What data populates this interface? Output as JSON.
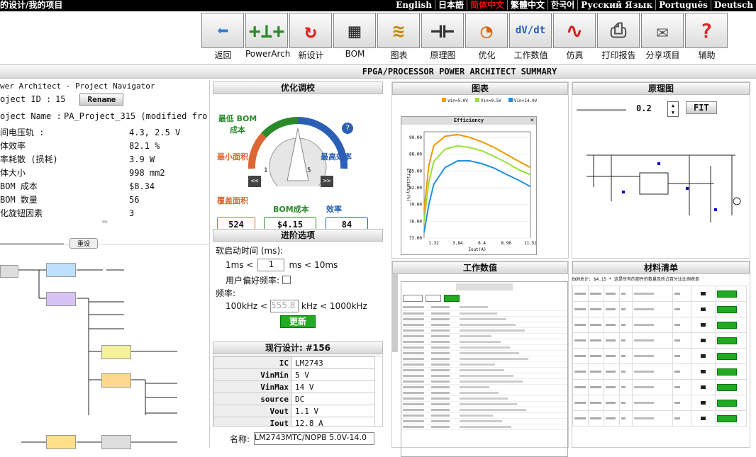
{
  "topbar": {
    "crumb": "的设计/我的项目",
    "languages": [
      "English",
      "日本語",
      "简体中文",
      "繁體中文",
      "한국어",
      "Русский Язык",
      "Português",
      "Deutsch"
    ],
    "active": "简体中文"
  },
  "toolbar": [
    {
      "label": "返回",
      "icon": "back-arrow-icon",
      "glyph": "⬅",
      "color": "#2a7fd4"
    },
    {
      "label": "PowerArch",
      "icon": "powerarch-icon",
      "glyph": "+⊥+",
      "color": "#2a8a2a"
    },
    {
      "label": "新设计",
      "icon": "refresh-icon",
      "glyph": "↻",
      "color": "#d22"
    },
    {
      "label": "BOM",
      "icon": "bom-icon",
      "glyph": "▦",
      "color": "#333"
    },
    {
      "label": "图表",
      "icon": "chart-icon",
      "glyph": "≋",
      "color": "#c80"
    },
    {
      "label": "原理图",
      "icon": "schematic-icon",
      "glyph": "⊣⊢",
      "color": "#333"
    },
    {
      "label": "优化",
      "icon": "optimize-knob-icon",
      "glyph": "◔",
      "color": "#d60"
    },
    {
      "label": "工作数值",
      "icon": "dvdt-icon",
      "glyph": "dV/dt",
      "color": "#2a5fb4"
    },
    {
      "label": "仿真",
      "icon": "sine-wave-icon",
      "glyph": "∿",
      "color": "#d22"
    },
    {
      "label": "打印报告",
      "icon": "printer-icon",
      "glyph": "⎙",
      "color": "#555"
    },
    {
      "label": "分享项目",
      "icon": "share-mail-icon",
      "glyph": "✉",
      "color": "#555"
    },
    {
      "label": "辅助",
      "icon": "help-icon",
      "glyph": "?",
      "color": "#d22"
    }
  ],
  "page_title": "FPGA/PROCESSOR POWER ARCHITECT SUMMARY",
  "nav": {
    "title": "wer Architect - Project Navigator",
    "project_id_label": "oject ID :",
    "project_id": "15",
    "rename": "Rename",
    "project_name_label": "oject Name :",
    "project_name": "PA_Project_315 (modified fro",
    "stats": [
      {
        "k": "间电压轨 :",
        "v": "4.3, 2.5 V"
      },
      {
        "k": "体效率",
        "v": "82.1 %"
      },
      {
        "k": "率耗散 (损耗)",
        "v": "3.9 W"
      },
      {
        "k": "体大小",
        "v": "998 mm2"
      },
      {
        "k": "BOM 成本",
        "v": "$8.34"
      },
      {
        "k": "BOM 数量",
        "v": "56"
      },
      {
        "k": "化旋钮因素",
        "v": "3"
      }
    ],
    "reset": "重设"
  },
  "optimize": {
    "header": "优化调校",
    "low_bom": "最低 BOM\n成本",
    "min_area": "最小面积",
    "max_eff": "最高效率",
    "knob_min": "1",
    "knob_max": "5",
    "prev": "<<",
    "next": ">>",
    "area_label": "覆盖面积",
    "bom_label": "BOM成本",
    "eff_label": "效率",
    "area": "524",
    "bom": "$4.15",
    "eff": "84"
  },
  "advanced": {
    "header": "进阶选项",
    "soft_start": "软启动时间 (ms):",
    "ss_min": "1ms <",
    "ss_val": "1",
    "ss_max": "ms < 10ms",
    "pref_freq": "用户偏好频率:",
    "freq": "频率:",
    "f_min": "100kHz <",
    "f_val": "555.8",
    "f_max": "kHz < 1000kHz",
    "update": "更新"
  },
  "current": {
    "header": "现行设计: #156",
    "rows": [
      [
        "IC",
        "LM2743"
      ],
      [
        "VinMin",
        "5 V"
      ],
      [
        "VinMax",
        "14 V"
      ],
      [
        "source",
        "DC"
      ],
      [
        "Vout",
        "1.1 V"
      ],
      [
        "Iout",
        "12.8 A"
      ]
    ],
    "name_label": "名称:",
    "name": "LM2743MTC/NOPB 5.0V-14.0"
  },
  "chart_panel": {
    "header": "图表",
    "legend": [
      "Vin=5.0V",
      "Vin=9.5V",
      "Vin=14.0V"
    ]
  },
  "chart_data": {
    "type": "line",
    "title": "Efficiency",
    "ylabel": "Efficiency(%)",
    "xlabel": "Iout(A)",
    "x": [
      1.32,
      3.84,
      6.4,
      8.96,
      11.52
    ],
    "ylim": [
      73,
      92
    ],
    "yticks": [
      73,
      76,
      79,
      82,
      85,
      88,
      91
    ],
    "yticklabels": [
      "73.00",
      "76.00",
      "79.00",
      "82.00",
      "85.00",
      "88.00",
      "90.00"
    ],
    "series": [
      {
        "name": "Vin=5.0V",
        "color": "#f09a00",
        "x": [
          0.3,
          0.8,
          1.32,
          2.5,
          3.84,
          5.1,
          6.4,
          7.7,
          8.96,
          10.2,
          11.52
        ],
        "values": [
          78,
          86,
          89.5,
          91.2,
          91.5,
          91.0,
          90.2,
          89.2,
          88.0,
          86.8,
          85.6
        ]
      },
      {
        "name": "Vin=9.5V",
        "color": "#99e03a",
        "x": [
          0.3,
          0.8,
          1.32,
          2.5,
          3.84,
          5.1,
          6.4,
          7.7,
          8.96,
          10.2,
          11.52
        ],
        "values": [
          76,
          83,
          86.7,
          88.9,
          89.5,
          89.2,
          88.6,
          87.6,
          86.5,
          85.3,
          84.3
        ]
      },
      {
        "name": "Vin=14.0V",
        "color": "#1e90e0",
        "x": [
          0.3,
          0.8,
          1.32,
          2.5,
          3.84,
          5.1,
          6.4,
          7.7,
          8.96,
          10.2,
          11.52
        ],
        "values": [
          74,
          79,
          82.6,
          85.6,
          86.8,
          86.8,
          86.3,
          85.5,
          84.4,
          83.4,
          82.2
        ]
      }
    ]
  },
  "schematic": {
    "header": "原理图",
    "zoom": "0.2",
    "fit": "FIT"
  },
  "opvals": {
    "header": "工作数值"
  },
  "bom": {
    "header": "材料清单",
    "note": "BOM总计: $4.15 * 这是所有的部件的数量及所占百分比比例表单"
  },
  "colors": {
    "accent_red": "#e00",
    "panel_gray": "#d6d6d6",
    "green": "#2a2"
  }
}
